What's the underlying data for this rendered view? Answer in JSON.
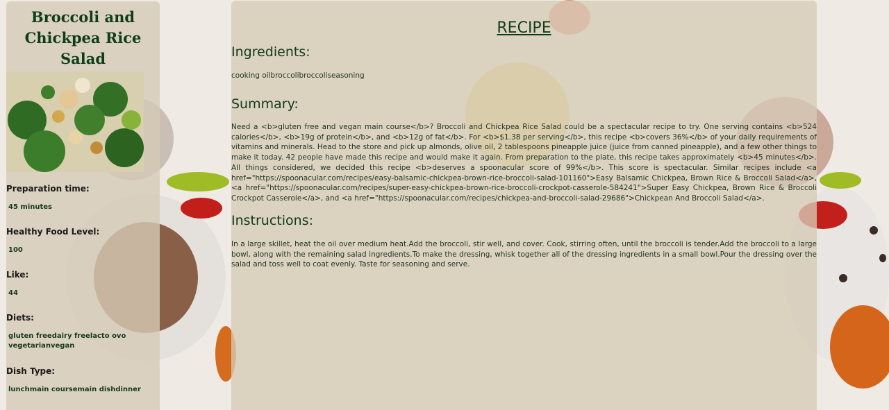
{
  "recipe": {
    "title": "Broccoli and Chickpea Rice Salad",
    "heading": "RECIPE"
  },
  "details": {
    "prep_label": "Preparation time:",
    "prep_value": "45 minutes",
    "health_label": "Healthy Food Level:",
    "health_value": "100",
    "like_label": "Like:",
    "like_value": "44",
    "diets_label": "Diets:",
    "diets_value": "gluten freedairy freelacto ovo vegetarianvegan",
    "dish_label": "Dish Type:",
    "dish_value": "lunchmain coursemain dishdinner"
  },
  "ingredients": {
    "title": "Ingredients:",
    "text": "cooking oilbroccolibroccoliseasoning"
  },
  "summary": {
    "title": "Summary:",
    "text": "Need a <b>gluten free and vegan main course</b>? Broccoli and Chickpea Rice Salad could be a spectacular recipe to try. One serving contains <b>524 calories</b>, <b>19g of protein</b>, and <b>12g of fat</b>. For <b>$1.38 per serving</b>, this recipe <b>covers 36%</b> of your daily requirements of vitamins and minerals. Head to the store and pick up almonds, olive oil, 2 tablespoons pineapple juice (juice from canned pineapple), and a few other things to make it today. 42 people have made this recipe and would make it again. From preparation to the plate, this recipe takes approximately <b>45 minutes</b>. All things considered, we decided this recipe <b>deserves a spoonacular score of 99%</b>. This score is spectacular. Similar recipes include <a href=\"https://spoonacular.com/recipes/easy-balsamic-chickpea-brown-rice-broccoli-salad-101160\">Easy Balsamic Chickpea, Brown Rice & Broccoli Salad</a>, <a href=\"https://spoonacular.com/recipes/super-easy-chickpea-brown-rice-broccoli-crockpot-casserole-584241\">Super Easy Chickpea, Brown Rice & Broccoli Crockpot Casserole</a>, and <a href=\"https://spoonacular.com/recipes/chickpea-and-broccoli-salad-29686\">Chickpean And Broccoli Salad</a>."
  },
  "instructions": {
    "title": "Instructions:",
    "text": "In a large skillet, heat the oil over medium heat.Add the broccoli, stir well, and cover. Cook, stirring often, until the broccoli is tender.Add the broccoli to a large bowl, along with the remaining salad ingredients.To make the dressing, whisk together all of the dressing ingredients in a small bowl.Pour the dressing over the salad and toss well to coat evenly. Taste for seasoning and serve."
  },
  "icons": {
    "dish_photo": "broccoli-salad-photo"
  }
}
